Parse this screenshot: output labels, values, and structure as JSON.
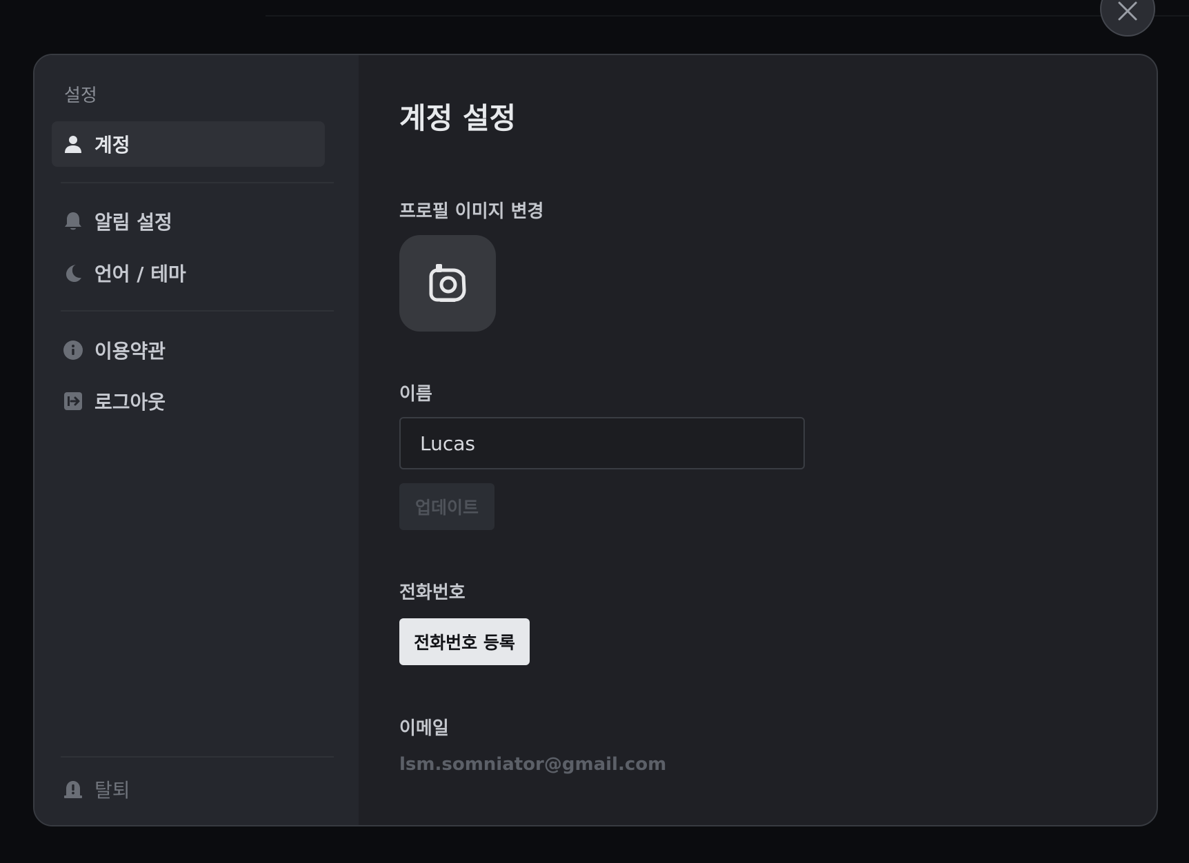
{
  "window": {
    "close_icon": "close-icon"
  },
  "sidebar": {
    "title": "설정",
    "items": [
      {
        "label": "계정",
        "icon": "user-icon",
        "active": true
      },
      {
        "label": "알림 설정",
        "icon": "bell-icon"
      },
      {
        "label": "언어 / 테마",
        "icon": "moon-icon"
      },
      {
        "label": "이용약관",
        "icon": "info-icon"
      },
      {
        "label": "로그아웃",
        "icon": "logout-icon"
      }
    ],
    "footer_item": {
      "label": "탈퇴",
      "icon": "alert-icon"
    }
  },
  "main": {
    "title": "계정 설정",
    "profile_image": {
      "label": "프로필 이미지 변경",
      "icon": "camera-icon"
    },
    "name": {
      "label": "이름",
      "value": "Lucas",
      "update_label": "업데이트"
    },
    "phone": {
      "label": "전화번호",
      "register_label": "전화번호 등록"
    },
    "email": {
      "label": "이메일",
      "value": "lsm.somniator@gmail.com"
    }
  },
  "colors": {
    "background": "#0b0c0f",
    "modal": "#1f2025",
    "sidebar": "#25272d",
    "primary_button": "#e6e8eb"
  }
}
